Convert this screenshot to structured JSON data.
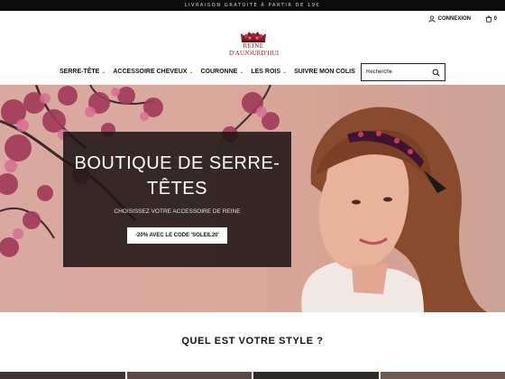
{
  "announcement": "LIVRAISON GRATUITE À PARTIR DE 19€",
  "header": {
    "account_label": "CONNEXION",
    "cart_count": "0",
    "logo_line1": "REINE",
    "logo_line2": "D'AUJOURD'HUI"
  },
  "nav": {
    "items": [
      {
        "label": "SERRE-TÊTE"
      },
      {
        "label": "ACCESSOIRE CHEVEUX"
      },
      {
        "label": "COURONNE"
      },
      {
        "label": "LES ROIS"
      },
      {
        "label": "SUIVRE MON COLIS"
      }
    ],
    "chevron": "⌄"
  },
  "search": {
    "placeholder": "Recherche"
  },
  "hero": {
    "title": "BOUTIQUE DE SERRE-TÊTES",
    "subtitle": "CHOISISSEZ VOTRE ACCESSOIRE DE REINE",
    "button": "-20% AVEC LE CODE 'SOLEIL20'"
  },
  "section": {
    "title": "QUEL EST VOTRE STYLE ?"
  },
  "colors": {
    "topbar": "#0d0d0d",
    "brand": "#7a1e28",
    "hero_bg": "#d9a99f",
    "hero_box": "#1e1616"
  }
}
